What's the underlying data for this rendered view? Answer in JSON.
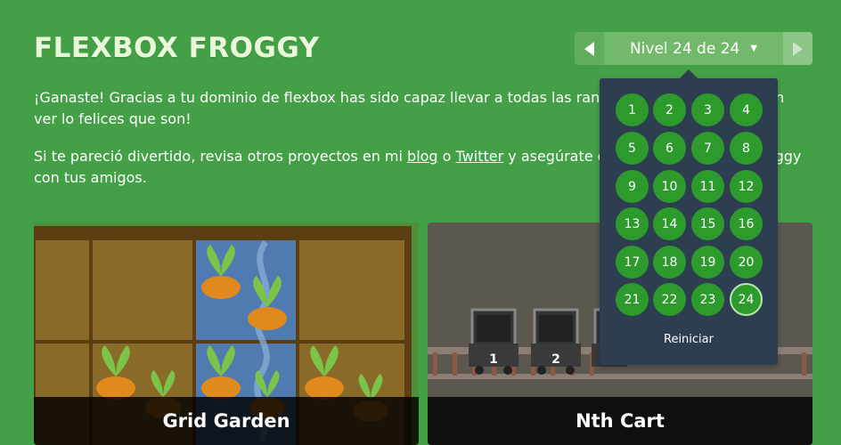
{
  "app": {
    "title": "FLEXBOX FROGGY"
  },
  "level_nav": {
    "label": "Nivel 24 de 24",
    "prev_icon": "chevron-left-icon",
    "next_icon": "chevron-right-icon",
    "caret_icon": "caret-down-icon"
  },
  "intro": {
    "p1": "¡Ganaste! Gracias a tu dominio de flexbox has sido capaz llevar a todas las ranas a su nenúfar. ¡Solo con ver lo felices que son!",
    "p2_before": "Si te pareció divertido, revisa otros proyectos en mi ",
    "blog_link": "blog",
    "p2_or": " o ",
    "twitter_link": "Twitter",
    "p2_after": " y asegúrate de compartir Flexbox Froggy con tus amigos."
  },
  "projects": [
    {
      "title": "Grid Garden"
    },
    {
      "title": "Nth Cart"
    }
  ],
  "level_menu": {
    "levels": [
      "1",
      "2",
      "3",
      "4",
      "5",
      "6",
      "7",
      "8",
      "9",
      "10",
      "11",
      "12",
      "13",
      "14",
      "15",
      "16",
      "17",
      "18",
      "19",
      "20",
      "21",
      "22",
      "23",
      "24"
    ],
    "current": "24",
    "reset_label": "Reiniciar"
  },
  "cart_numbers": [
    "1",
    "2"
  ],
  "colors": {
    "background": "#44a047",
    "menu": "#2c3e50",
    "level_button": "#2c9b2c",
    "title_text": "#e9f8d8"
  }
}
